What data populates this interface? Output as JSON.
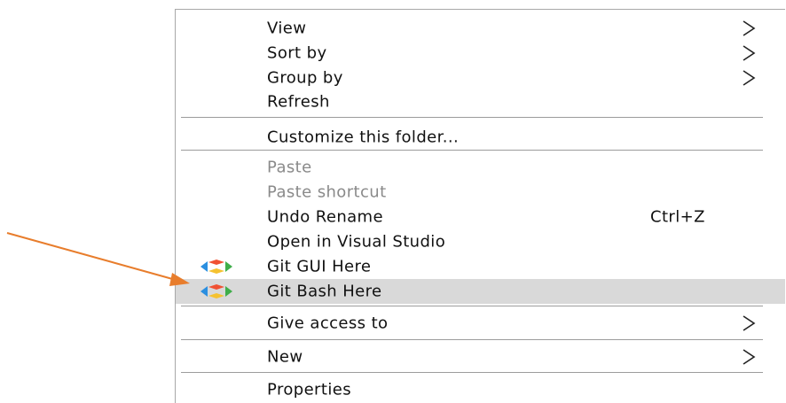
{
  "menu": {
    "items": [
      {
        "label": "View",
        "submenu": true
      },
      {
        "label": "Sort by",
        "submenu": true
      },
      {
        "label": "Group by",
        "submenu": true
      },
      {
        "label": "Refresh"
      },
      {
        "label": "Customize this folder..."
      },
      {
        "label": "Paste",
        "disabled": true
      },
      {
        "label": "Paste shortcut",
        "disabled": true
      },
      {
        "label": "Undo Rename",
        "shortcut": "Ctrl+Z"
      },
      {
        "label": "Open in Visual Studio"
      },
      {
        "label": "Git GUI Here",
        "icon": "git-icon"
      },
      {
        "label": "Git Bash Here",
        "icon": "git-icon",
        "highlighted": true
      },
      {
        "label": "Give access to",
        "submenu": true
      },
      {
        "label": "New",
        "submenu": true
      },
      {
        "label": "Properties"
      }
    ]
  },
  "colors": {
    "highlight": "#d9d9d9",
    "disabled_text": "#8a8a8a",
    "annotation_arrow": "#e87d2c",
    "git_blue": "#2b8fe0",
    "git_orange": "#f05133",
    "git_yellow": "#f5c230",
    "git_green": "#3fae4a"
  }
}
